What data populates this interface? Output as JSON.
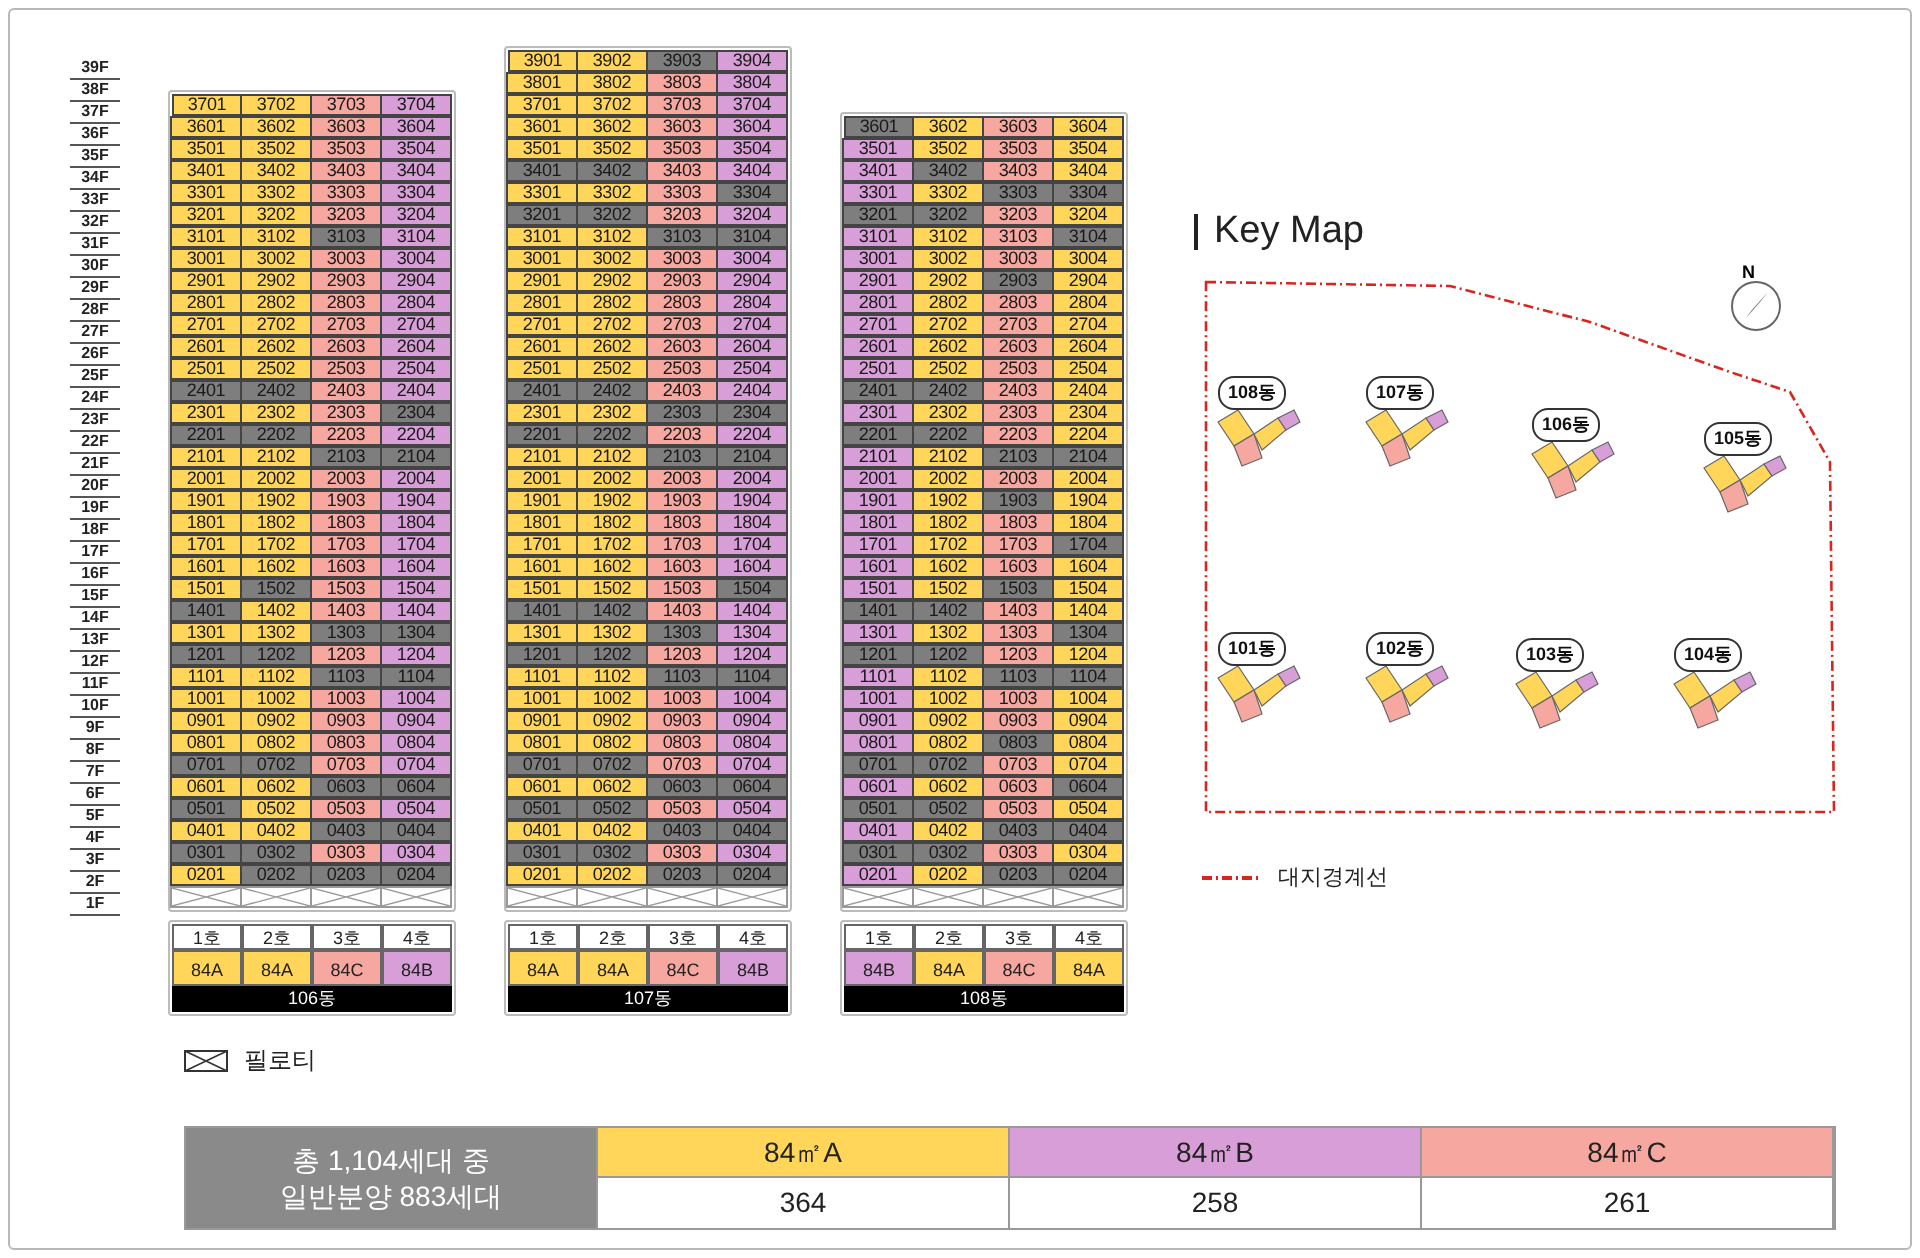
{
  "floor_labels": [
    "39F",
    "38F",
    "37F",
    "36F",
    "35F",
    "34F",
    "33F",
    "32F",
    "31F",
    "30F",
    "29F",
    "28F",
    "27F",
    "26F",
    "25F",
    "24F",
    "23F",
    "22F",
    "21F",
    "20F",
    "19F",
    "18F",
    "17F",
    "16F",
    "15F",
    "14F",
    "13F",
    "12F",
    "11F",
    "10F",
    "9F",
    "8F",
    "7F",
    "6F",
    "5F",
    "4F",
    "3F",
    "2F",
    "1F"
  ],
  "buildings": [
    {
      "name": "106동",
      "units": [
        {
          "label": "1호",
          "type": "84A",
          "kind": "A"
        },
        {
          "label": "2호",
          "type": "84A",
          "kind": "A"
        },
        {
          "label": "3호",
          "type": "84C",
          "kind": "C"
        },
        {
          "label": "4호",
          "type": "84B",
          "kind": "B"
        }
      ],
      "floors": [
        [
          {
            "no": "3701",
            "reserved": false
          },
          {
            "no": "3702",
            "reserved": false
          },
          {
            "no": "3703",
            "reserved": false
          },
          {
            "no": "3704",
            "reserved": false
          }
        ],
        [
          {
            "no": "3601",
            "reserved": false
          },
          {
            "no": "3602",
            "reserved": false
          },
          {
            "no": "3603",
            "reserved": false
          },
          {
            "no": "3604",
            "reserved": false
          }
        ],
        [
          {
            "no": "3501",
            "reserved": false
          },
          {
            "no": "3502",
            "reserved": false
          },
          {
            "no": "3503",
            "reserved": false
          },
          {
            "no": "3504",
            "reserved": false
          }
        ],
        [
          {
            "no": "3401",
            "reserved": false
          },
          {
            "no": "3402",
            "reserved": false
          },
          {
            "no": "3403",
            "reserved": false
          },
          {
            "no": "3404",
            "reserved": false
          }
        ],
        [
          {
            "no": "3301",
            "reserved": false
          },
          {
            "no": "3302",
            "reserved": false
          },
          {
            "no": "3303",
            "reserved": false
          },
          {
            "no": "3304",
            "reserved": false
          }
        ],
        [
          {
            "no": "3201",
            "reserved": false
          },
          {
            "no": "3202",
            "reserved": false
          },
          {
            "no": "3203",
            "reserved": false
          },
          {
            "no": "3204",
            "reserved": false
          }
        ],
        [
          {
            "no": "3101",
            "reserved": false
          },
          {
            "no": "3102",
            "reserved": false
          },
          {
            "no": "3103",
            "reserved": true
          },
          {
            "no": "3104",
            "reserved": false
          }
        ],
        [
          {
            "no": "3001",
            "reserved": false
          },
          {
            "no": "3002",
            "reserved": false
          },
          {
            "no": "3003",
            "reserved": false
          },
          {
            "no": "3004",
            "reserved": false
          }
        ],
        [
          {
            "no": "2901",
            "reserved": false
          },
          {
            "no": "2902",
            "reserved": false
          },
          {
            "no": "2903",
            "reserved": false
          },
          {
            "no": "2904",
            "reserved": false
          }
        ],
        [
          {
            "no": "2801",
            "reserved": false
          },
          {
            "no": "2802",
            "reserved": false
          },
          {
            "no": "2803",
            "reserved": false
          },
          {
            "no": "2804",
            "reserved": false
          }
        ],
        [
          {
            "no": "2701",
            "reserved": false
          },
          {
            "no": "2702",
            "reserved": false
          },
          {
            "no": "2703",
            "reserved": false
          },
          {
            "no": "2704",
            "reserved": false
          }
        ],
        [
          {
            "no": "2601",
            "reserved": false
          },
          {
            "no": "2602",
            "reserved": false
          },
          {
            "no": "2603",
            "reserved": false
          },
          {
            "no": "2604",
            "reserved": false
          }
        ],
        [
          {
            "no": "2501",
            "reserved": false
          },
          {
            "no": "2502",
            "reserved": false
          },
          {
            "no": "2503",
            "reserved": false
          },
          {
            "no": "2504",
            "reserved": false
          }
        ],
        [
          {
            "no": "2401",
            "reserved": true
          },
          {
            "no": "2402",
            "reserved": true
          },
          {
            "no": "2403",
            "reserved": false
          },
          {
            "no": "2404",
            "reserved": false
          }
        ],
        [
          {
            "no": "2301",
            "reserved": false
          },
          {
            "no": "2302",
            "reserved": false
          },
          {
            "no": "2303",
            "reserved": false
          },
          {
            "no": "2304",
            "reserved": true
          }
        ],
        [
          {
            "no": "2201",
            "reserved": true
          },
          {
            "no": "2202",
            "reserved": true
          },
          {
            "no": "2203",
            "reserved": false
          },
          {
            "no": "2204",
            "reserved": false
          }
        ],
        [
          {
            "no": "2101",
            "reserved": false
          },
          {
            "no": "2102",
            "reserved": false
          },
          {
            "no": "2103",
            "reserved": true
          },
          {
            "no": "2104",
            "reserved": true
          }
        ],
        [
          {
            "no": "2001",
            "reserved": false
          },
          {
            "no": "2002",
            "reserved": false
          },
          {
            "no": "2003",
            "reserved": false
          },
          {
            "no": "2004",
            "reserved": false
          }
        ],
        [
          {
            "no": "1901",
            "reserved": false
          },
          {
            "no": "1902",
            "reserved": false
          },
          {
            "no": "1903",
            "reserved": false
          },
          {
            "no": "1904",
            "reserved": false
          }
        ],
        [
          {
            "no": "1801",
            "reserved": false
          },
          {
            "no": "1802",
            "reserved": false
          },
          {
            "no": "1803",
            "reserved": false
          },
          {
            "no": "1804",
            "reserved": false
          }
        ],
        [
          {
            "no": "1701",
            "reserved": false
          },
          {
            "no": "1702",
            "reserved": false
          },
          {
            "no": "1703",
            "reserved": false
          },
          {
            "no": "1704",
            "reserved": false
          }
        ],
        [
          {
            "no": "1601",
            "reserved": false
          },
          {
            "no": "1602",
            "reserved": false
          },
          {
            "no": "1603",
            "reserved": false
          },
          {
            "no": "1604",
            "reserved": false
          }
        ],
        [
          {
            "no": "1501",
            "reserved": false
          },
          {
            "no": "1502",
            "reserved": true
          },
          {
            "no": "1503",
            "reserved": false
          },
          {
            "no": "1504",
            "reserved": false
          }
        ],
        [
          {
            "no": "1401",
            "reserved": true
          },
          {
            "no": "1402",
            "reserved": false
          },
          {
            "no": "1403",
            "reserved": false
          },
          {
            "no": "1404",
            "reserved": false
          }
        ],
        [
          {
            "no": "1301",
            "reserved": false
          },
          {
            "no": "1302",
            "reserved": false
          },
          {
            "no": "1303",
            "reserved": true
          },
          {
            "no": "1304",
            "reserved": true
          }
        ],
        [
          {
            "no": "1201",
            "reserved": true
          },
          {
            "no": "1202",
            "reserved": true
          },
          {
            "no": "1203",
            "reserved": false
          },
          {
            "no": "1204",
            "reserved": false
          }
        ],
        [
          {
            "no": "1101",
            "reserved": false
          },
          {
            "no": "1102",
            "reserved": false
          },
          {
            "no": "1103",
            "reserved": true
          },
          {
            "no": "1104",
            "reserved": true
          }
        ],
        [
          {
            "no": "1001",
            "reserved": false
          },
          {
            "no": "1002",
            "reserved": false
          },
          {
            "no": "1003",
            "reserved": false
          },
          {
            "no": "1004",
            "reserved": false
          }
        ],
        [
          {
            "no": "0901",
            "reserved": false
          },
          {
            "no": "0902",
            "reserved": false
          },
          {
            "no": "0903",
            "reserved": false
          },
          {
            "no": "0904",
            "reserved": false
          }
        ],
        [
          {
            "no": "0801",
            "reserved": false
          },
          {
            "no": "0802",
            "reserved": false
          },
          {
            "no": "0803",
            "reserved": false
          },
          {
            "no": "0804",
            "reserved": false
          }
        ],
        [
          {
            "no": "0701",
            "reserved": true
          },
          {
            "no": "0702",
            "reserved": true
          },
          {
            "no": "0703",
            "reserved": false
          },
          {
            "no": "0704",
            "reserved": false
          }
        ],
        [
          {
            "no": "0601",
            "reserved": false
          },
          {
            "no": "0602",
            "reserved": false
          },
          {
            "no": "0603",
            "reserved": true
          },
          {
            "no": "0604",
            "reserved": true
          }
        ],
        [
          {
            "no": "0501",
            "reserved": true
          },
          {
            "no": "0502",
            "reserved": false
          },
          {
            "no": "0503",
            "reserved": false
          },
          {
            "no": "0504",
            "reserved": false
          }
        ],
        [
          {
            "no": "0401",
            "reserved": false
          },
          {
            "no": "0402",
            "reserved": false
          },
          {
            "no": "0403",
            "reserved": true
          },
          {
            "no": "0404",
            "reserved": true
          }
        ],
        [
          {
            "no": "0301",
            "reserved": true
          },
          {
            "no": "0302",
            "reserved": true
          },
          {
            "no": "0303",
            "reserved": false
          },
          {
            "no": "0304",
            "reserved": false
          }
        ],
        [
          {
            "no": "0201",
            "reserved": false
          },
          {
            "no": "0202",
            "reserved": true
          },
          {
            "no": "0203",
            "reserved": true
          },
          {
            "no": "0204",
            "reserved": true
          }
        ]
      ]
    },
    {
      "name": "107동",
      "units": [
        {
          "label": "1호",
          "type": "84A",
          "kind": "A"
        },
        {
          "label": "2호",
          "type": "84A",
          "kind": "A"
        },
        {
          "label": "3호",
          "type": "84C",
          "kind": "C"
        },
        {
          "label": "4호",
          "type": "84B",
          "kind": "B"
        }
      ],
      "floors": [
        [
          {
            "no": "3901",
            "reserved": false
          },
          {
            "no": "3902",
            "reserved": false
          },
          {
            "no": "3903",
            "reserved": true
          },
          {
            "no": "3904",
            "reserved": false
          }
        ],
        [
          {
            "no": "3801",
            "reserved": false
          },
          {
            "no": "3802",
            "reserved": false
          },
          {
            "no": "3803",
            "reserved": false
          },
          {
            "no": "3804",
            "reserved": false
          }
        ],
        [
          {
            "no": "3701",
            "reserved": false
          },
          {
            "no": "3702",
            "reserved": false
          },
          {
            "no": "3703",
            "reserved": false
          },
          {
            "no": "3704",
            "reserved": false
          }
        ],
        [
          {
            "no": "3601",
            "reserved": false
          },
          {
            "no": "3602",
            "reserved": false
          },
          {
            "no": "3603",
            "reserved": false
          },
          {
            "no": "3604",
            "reserved": false
          }
        ],
        [
          {
            "no": "3501",
            "reserved": false
          },
          {
            "no": "3502",
            "reserved": false
          },
          {
            "no": "3503",
            "reserved": false
          },
          {
            "no": "3504",
            "reserved": false
          }
        ],
        [
          {
            "no": "3401",
            "reserved": true
          },
          {
            "no": "3402",
            "reserved": true
          },
          {
            "no": "3403",
            "reserved": false
          },
          {
            "no": "3404",
            "reserved": false
          }
        ],
        [
          {
            "no": "3301",
            "reserved": false
          },
          {
            "no": "3302",
            "reserved": false
          },
          {
            "no": "3303",
            "reserved": false
          },
          {
            "no": "3304",
            "reserved": true
          }
        ],
        [
          {
            "no": "3201",
            "reserved": true
          },
          {
            "no": "3202",
            "reserved": true
          },
          {
            "no": "3203",
            "reserved": false
          },
          {
            "no": "3204",
            "reserved": false
          }
        ],
        [
          {
            "no": "3101",
            "reserved": false
          },
          {
            "no": "3102",
            "reserved": false
          },
          {
            "no": "3103",
            "reserved": true
          },
          {
            "no": "3104",
            "reserved": true
          }
        ],
        [
          {
            "no": "3001",
            "reserved": false
          },
          {
            "no": "3002",
            "reserved": false
          },
          {
            "no": "3003",
            "reserved": false
          },
          {
            "no": "3004",
            "reserved": false
          }
        ],
        [
          {
            "no": "2901",
            "reserved": false
          },
          {
            "no": "2902",
            "reserved": false
          },
          {
            "no": "2903",
            "reserved": false
          },
          {
            "no": "2904",
            "reserved": false
          }
        ],
        [
          {
            "no": "2801",
            "reserved": false
          },
          {
            "no": "2802",
            "reserved": false
          },
          {
            "no": "2803",
            "reserved": false
          },
          {
            "no": "2804",
            "reserved": false
          }
        ],
        [
          {
            "no": "2701",
            "reserved": false
          },
          {
            "no": "2702",
            "reserved": false
          },
          {
            "no": "2703",
            "reserved": false
          },
          {
            "no": "2704",
            "reserved": false
          }
        ],
        [
          {
            "no": "2601",
            "reserved": false
          },
          {
            "no": "2602",
            "reserved": false
          },
          {
            "no": "2603",
            "reserved": false
          },
          {
            "no": "2604",
            "reserved": false
          }
        ],
        [
          {
            "no": "2501",
            "reserved": false
          },
          {
            "no": "2502",
            "reserved": false
          },
          {
            "no": "2503",
            "reserved": false
          },
          {
            "no": "2504",
            "reserved": false
          }
        ],
        [
          {
            "no": "2401",
            "reserved": true
          },
          {
            "no": "2402",
            "reserved": true
          },
          {
            "no": "2403",
            "reserved": false
          },
          {
            "no": "2404",
            "reserved": false
          }
        ],
        [
          {
            "no": "2301",
            "reserved": false
          },
          {
            "no": "2302",
            "reserved": false
          },
          {
            "no": "2303",
            "reserved": true
          },
          {
            "no": "2304",
            "reserved": true
          }
        ],
        [
          {
            "no": "2201",
            "reserved": true
          },
          {
            "no": "2202",
            "reserved": true
          },
          {
            "no": "2203",
            "reserved": false
          },
          {
            "no": "2204",
            "reserved": false
          }
        ],
        [
          {
            "no": "2101",
            "reserved": false
          },
          {
            "no": "2102",
            "reserved": false
          },
          {
            "no": "2103",
            "reserved": true
          },
          {
            "no": "2104",
            "reserved": true
          }
        ],
        [
          {
            "no": "2001",
            "reserved": false
          },
          {
            "no": "2002",
            "reserved": false
          },
          {
            "no": "2003",
            "reserved": false
          },
          {
            "no": "2004",
            "reserved": false
          }
        ],
        [
          {
            "no": "1901",
            "reserved": false
          },
          {
            "no": "1902",
            "reserved": false
          },
          {
            "no": "1903",
            "reserved": false
          },
          {
            "no": "1904",
            "reserved": false
          }
        ],
        [
          {
            "no": "1801",
            "reserved": false
          },
          {
            "no": "1802",
            "reserved": false
          },
          {
            "no": "1803",
            "reserved": false
          },
          {
            "no": "1804",
            "reserved": false
          }
        ],
        [
          {
            "no": "1701",
            "reserved": false
          },
          {
            "no": "1702",
            "reserved": false
          },
          {
            "no": "1703",
            "reserved": false
          },
          {
            "no": "1704",
            "reserved": false
          }
        ],
        [
          {
            "no": "1601",
            "reserved": false
          },
          {
            "no": "1602",
            "reserved": false
          },
          {
            "no": "1603",
            "reserved": false
          },
          {
            "no": "1604",
            "reserved": false
          }
        ],
        [
          {
            "no": "1501",
            "reserved": false
          },
          {
            "no": "1502",
            "reserved": false
          },
          {
            "no": "1503",
            "reserved": false
          },
          {
            "no": "1504",
            "reserved": true
          }
        ],
        [
          {
            "no": "1401",
            "reserved": true
          },
          {
            "no": "1402",
            "reserved": true
          },
          {
            "no": "1403",
            "reserved": false
          },
          {
            "no": "1404",
            "reserved": false
          }
        ],
        [
          {
            "no": "1301",
            "reserved": false
          },
          {
            "no": "1302",
            "reserved": false
          },
          {
            "no": "1303",
            "reserved": true
          },
          {
            "no": "1304",
            "reserved": false
          }
        ],
        [
          {
            "no": "1201",
            "reserved": true
          },
          {
            "no": "1202",
            "reserved": true
          },
          {
            "no": "1203",
            "reserved": false
          },
          {
            "no": "1204",
            "reserved": false
          }
        ],
        [
          {
            "no": "1101",
            "reserved": false
          },
          {
            "no": "1102",
            "reserved": false
          },
          {
            "no": "1103",
            "reserved": true
          },
          {
            "no": "1104",
            "reserved": true
          }
        ],
        [
          {
            "no": "1001",
            "reserved": false
          },
          {
            "no": "1002",
            "reserved": false
          },
          {
            "no": "1003",
            "reserved": false
          },
          {
            "no": "1004",
            "reserved": false
          }
        ],
        [
          {
            "no": "0901",
            "reserved": false
          },
          {
            "no": "0902",
            "reserved": false
          },
          {
            "no": "0903",
            "reserved": false
          },
          {
            "no": "0904",
            "reserved": false
          }
        ],
        [
          {
            "no": "0801",
            "reserved": false
          },
          {
            "no": "0802",
            "reserved": false
          },
          {
            "no": "0803",
            "reserved": false
          },
          {
            "no": "0804",
            "reserved": false
          }
        ],
        [
          {
            "no": "0701",
            "reserved": true
          },
          {
            "no": "0702",
            "reserved": true
          },
          {
            "no": "0703",
            "reserved": false
          },
          {
            "no": "0704",
            "reserved": false
          }
        ],
        [
          {
            "no": "0601",
            "reserved": false
          },
          {
            "no": "0602",
            "reserved": false
          },
          {
            "no": "0603",
            "reserved": true
          },
          {
            "no": "0604",
            "reserved": true
          }
        ],
        [
          {
            "no": "0501",
            "reserved": true
          },
          {
            "no": "0502",
            "reserved": true
          },
          {
            "no": "0503",
            "reserved": false
          },
          {
            "no": "0504",
            "reserved": false
          }
        ],
        [
          {
            "no": "0401",
            "reserved": false
          },
          {
            "no": "0402",
            "reserved": false
          },
          {
            "no": "0403",
            "reserved": true
          },
          {
            "no": "0404",
            "reserved": true
          }
        ],
        [
          {
            "no": "0301",
            "reserved": true
          },
          {
            "no": "0302",
            "reserved": true
          },
          {
            "no": "0303",
            "reserved": false
          },
          {
            "no": "0304",
            "reserved": false
          }
        ],
        [
          {
            "no": "0201",
            "reserved": false
          },
          {
            "no": "0202",
            "reserved": false
          },
          {
            "no": "0203",
            "reserved": true
          },
          {
            "no": "0204",
            "reserved": true
          }
        ]
      ]
    },
    {
      "name": "108동",
      "units": [
        {
          "label": "1호",
          "type": "84B",
          "kind": "B"
        },
        {
          "label": "2호",
          "type": "84A",
          "kind": "A"
        },
        {
          "label": "3호",
          "type": "84C",
          "kind": "C"
        },
        {
          "label": "4호",
          "type": "84A",
          "kind": "A"
        }
      ],
      "floors": [
        [
          {
            "no": "3601",
            "reserved": true
          },
          {
            "no": "3602",
            "reserved": false
          },
          {
            "no": "3603",
            "reserved": false
          },
          {
            "no": "3604",
            "reserved": false
          }
        ],
        [
          {
            "no": "3501",
            "reserved": false
          },
          {
            "no": "3502",
            "reserved": false
          },
          {
            "no": "3503",
            "reserved": false
          },
          {
            "no": "3504",
            "reserved": false
          }
        ],
        [
          {
            "no": "3401",
            "reserved": false
          },
          {
            "no": "3402",
            "reserved": true
          },
          {
            "no": "3403",
            "reserved": false
          },
          {
            "no": "3404",
            "reserved": false
          }
        ],
        [
          {
            "no": "3301",
            "reserved": false
          },
          {
            "no": "3302",
            "reserved": false
          },
          {
            "no": "3303",
            "reserved": true
          },
          {
            "no": "3304",
            "reserved": true
          }
        ],
        [
          {
            "no": "3201",
            "reserved": true
          },
          {
            "no": "3202",
            "reserved": true
          },
          {
            "no": "3203",
            "reserved": false
          },
          {
            "no": "3204",
            "reserved": false
          }
        ],
        [
          {
            "no": "3101",
            "reserved": false
          },
          {
            "no": "3102",
            "reserved": false
          },
          {
            "no": "3103",
            "reserved": false
          },
          {
            "no": "3104",
            "reserved": true
          }
        ],
        [
          {
            "no": "3001",
            "reserved": false
          },
          {
            "no": "3002",
            "reserved": false
          },
          {
            "no": "3003",
            "reserved": false
          },
          {
            "no": "3004",
            "reserved": false
          }
        ],
        [
          {
            "no": "2901",
            "reserved": false
          },
          {
            "no": "2902",
            "reserved": false
          },
          {
            "no": "2903",
            "reserved": true
          },
          {
            "no": "2904",
            "reserved": false
          }
        ],
        [
          {
            "no": "2801",
            "reserved": false
          },
          {
            "no": "2802",
            "reserved": false
          },
          {
            "no": "2803",
            "reserved": false
          },
          {
            "no": "2804",
            "reserved": false
          }
        ],
        [
          {
            "no": "2701",
            "reserved": false
          },
          {
            "no": "2702",
            "reserved": false
          },
          {
            "no": "2703",
            "reserved": false
          },
          {
            "no": "2704",
            "reserved": false
          }
        ],
        [
          {
            "no": "2601",
            "reserved": false
          },
          {
            "no": "2602",
            "reserved": false
          },
          {
            "no": "2603",
            "reserved": false
          },
          {
            "no": "2604",
            "reserved": false
          }
        ],
        [
          {
            "no": "2501",
            "reserved": false
          },
          {
            "no": "2502",
            "reserved": false
          },
          {
            "no": "2503",
            "reserved": false
          },
          {
            "no": "2504",
            "reserved": false
          }
        ],
        [
          {
            "no": "2401",
            "reserved": true
          },
          {
            "no": "2402",
            "reserved": true
          },
          {
            "no": "2403",
            "reserved": false
          },
          {
            "no": "2404",
            "reserved": false
          }
        ],
        [
          {
            "no": "2301",
            "reserved": false
          },
          {
            "no": "2302",
            "reserved": false
          },
          {
            "no": "2303",
            "reserved": false
          },
          {
            "no": "2304",
            "reserved": false
          }
        ],
        [
          {
            "no": "2201",
            "reserved": true
          },
          {
            "no": "2202",
            "reserved": true
          },
          {
            "no": "2203",
            "reserved": false
          },
          {
            "no": "2204",
            "reserved": false
          }
        ],
        [
          {
            "no": "2101",
            "reserved": false
          },
          {
            "no": "2102",
            "reserved": false
          },
          {
            "no": "2103",
            "reserved": true
          },
          {
            "no": "2104",
            "reserved": true
          }
        ],
        [
          {
            "no": "2001",
            "reserved": false
          },
          {
            "no": "2002",
            "reserved": false
          },
          {
            "no": "2003",
            "reserved": false
          },
          {
            "no": "2004",
            "reserved": false
          }
        ],
        [
          {
            "no": "1901",
            "reserved": false
          },
          {
            "no": "1902",
            "reserved": false
          },
          {
            "no": "1903",
            "reserved": true
          },
          {
            "no": "1904",
            "reserved": false
          }
        ],
        [
          {
            "no": "1801",
            "reserved": false
          },
          {
            "no": "1802",
            "reserved": false
          },
          {
            "no": "1803",
            "reserved": false
          },
          {
            "no": "1804",
            "reserved": false
          }
        ],
        [
          {
            "no": "1701",
            "reserved": false
          },
          {
            "no": "1702",
            "reserved": false
          },
          {
            "no": "1703",
            "reserved": false
          },
          {
            "no": "1704",
            "reserved": true
          }
        ],
        [
          {
            "no": "1601",
            "reserved": false
          },
          {
            "no": "1602",
            "reserved": false
          },
          {
            "no": "1603",
            "reserved": false
          },
          {
            "no": "1604",
            "reserved": false
          }
        ],
        [
          {
            "no": "1501",
            "reserved": false
          },
          {
            "no": "1502",
            "reserved": false
          },
          {
            "no": "1503",
            "reserved": true
          },
          {
            "no": "1504",
            "reserved": false
          }
        ],
        [
          {
            "no": "1401",
            "reserved": true
          },
          {
            "no": "1402",
            "reserved": true
          },
          {
            "no": "1403",
            "reserved": false
          },
          {
            "no": "1404",
            "reserved": false
          }
        ],
        [
          {
            "no": "1301",
            "reserved": false
          },
          {
            "no": "1302",
            "reserved": false
          },
          {
            "no": "1303",
            "reserved": false
          },
          {
            "no": "1304",
            "reserved": true
          }
        ],
        [
          {
            "no": "1201",
            "reserved": true
          },
          {
            "no": "1202",
            "reserved": true
          },
          {
            "no": "1203",
            "reserved": false
          },
          {
            "no": "1204",
            "reserved": false
          }
        ],
        [
          {
            "no": "1101",
            "reserved": false
          },
          {
            "no": "1102",
            "reserved": false
          },
          {
            "no": "1103",
            "reserved": true
          },
          {
            "no": "1104",
            "reserved": true
          }
        ],
        [
          {
            "no": "1001",
            "reserved": false
          },
          {
            "no": "1002",
            "reserved": false
          },
          {
            "no": "1003",
            "reserved": false
          },
          {
            "no": "1004",
            "reserved": false
          }
        ],
        [
          {
            "no": "0901",
            "reserved": false
          },
          {
            "no": "0902",
            "reserved": false
          },
          {
            "no": "0903",
            "reserved": false
          },
          {
            "no": "0904",
            "reserved": false
          }
        ],
        [
          {
            "no": "0801",
            "reserved": false
          },
          {
            "no": "0802",
            "reserved": false
          },
          {
            "no": "0803",
            "reserved": true
          },
          {
            "no": "0804",
            "reserved": false
          }
        ],
        [
          {
            "no": "0701",
            "reserved": true
          },
          {
            "no": "0702",
            "reserved": true
          },
          {
            "no": "0703",
            "reserved": false
          },
          {
            "no": "0704",
            "reserved": false
          }
        ],
        [
          {
            "no": "0601",
            "reserved": false
          },
          {
            "no": "0602",
            "reserved": false
          },
          {
            "no": "0603",
            "reserved": false
          },
          {
            "no": "0604",
            "reserved": true
          }
        ],
        [
          {
            "no": "0501",
            "reserved": true
          },
          {
            "no": "0502",
            "reserved": true
          },
          {
            "no": "0503",
            "reserved": false
          },
          {
            "no": "0504",
            "reserved": false
          }
        ],
        [
          {
            "no": "0401",
            "reserved": false
          },
          {
            "no": "0402",
            "reserved": false
          },
          {
            "no": "0403",
            "reserved": true
          },
          {
            "no": "0404",
            "reserved": true
          }
        ],
        [
          {
            "no": "0301",
            "reserved": true
          },
          {
            "no": "0302",
            "reserved": true
          },
          {
            "no": "0303",
            "reserved": false
          },
          {
            "no": "0304",
            "reserved": false
          }
        ],
        [
          {
            "no": "0201",
            "reserved": false
          },
          {
            "no": "0202",
            "reserved": false
          },
          {
            "no": "0203",
            "reserved": true
          },
          {
            "no": "0204",
            "reserved": true
          }
        ]
      ]
    }
  ],
  "pilotis_legend": "필로티",
  "key_map": {
    "title": "Key Map",
    "north": "N",
    "buildings": [
      "108동",
      "107동",
      "106동",
      "105동",
      "101동",
      "102동",
      "103동",
      "104동"
    ],
    "legend": "대지경계선"
  },
  "summary": {
    "total": [
      "총 1,104세대 중",
      "일반분양 883세대"
    ],
    "types": [
      {
        "name": "84㎡A",
        "count": "364",
        "kind": "A"
      },
      {
        "name": "84㎡B",
        "count": "258",
        "kind": "B"
      },
      {
        "name": "84㎡C",
        "count": "261",
        "kind": "C"
      }
    ]
  }
}
